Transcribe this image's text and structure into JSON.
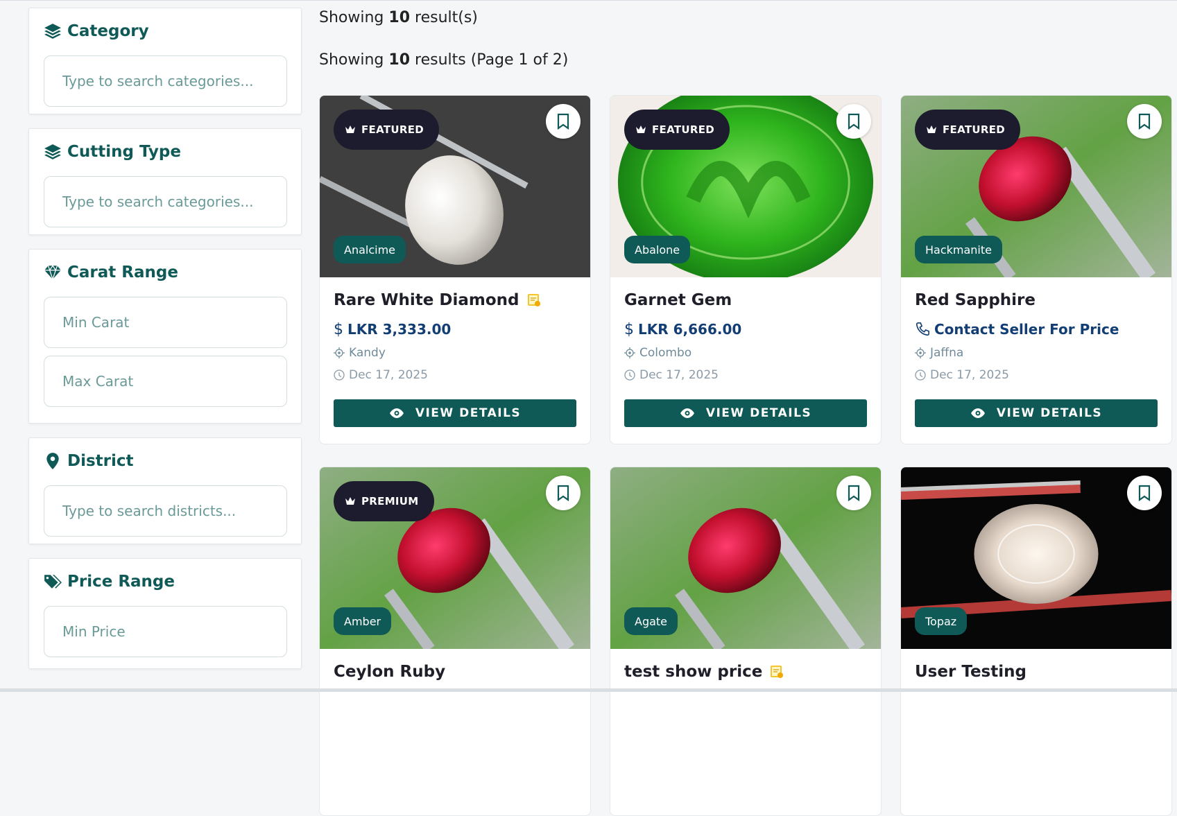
{
  "filters": [
    {
      "title": "Category",
      "icon": "layers-icon",
      "inputs": [
        "Type to search categories..."
      ]
    },
    {
      "title": "Cutting Type",
      "icon": "layers-icon",
      "inputs": [
        "Type to search categories..."
      ]
    },
    {
      "title": "Carat Range",
      "icon": "gem-icon",
      "inputs": [
        "Min Carat",
        "Max Carat"
      ]
    },
    {
      "title": "District",
      "icon": "map-pin-icon",
      "inputs": [
        "Type to search districts..."
      ]
    },
    {
      "title": "Price Range",
      "icon": "tags-icon",
      "inputs": [
        "Min Price"
      ]
    }
  ],
  "results": {
    "top_prefix": "Showing",
    "top_count": "10",
    "top_suffix": "result(s)",
    "page_prefix": "Showing",
    "page_count": "10",
    "page_suffix": "results (Page 1 of 2)"
  },
  "view_details_label": "VIEW DETAILS",
  "listings": [
    {
      "title": "Rare White Diamond",
      "certified": true,
      "badge": "FEATURED",
      "category": "Analcime",
      "price": "LKR 3,333.00",
      "price_type": "price",
      "location": "Kandy",
      "date": "Dec 17, 2025"
    },
    {
      "title": "Garnet Gem",
      "certified": false,
      "badge": "FEATURED",
      "category": "Abalone",
      "price": "LKR 6,666.00",
      "price_type": "price",
      "location": "Colombo",
      "date": "Dec 17, 2025"
    },
    {
      "title": "Red Sapphire",
      "certified": false,
      "badge": "FEATURED",
      "category": "Hackmanite",
      "price": "Contact Seller For Price",
      "price_type": "contact",
      "location": "Jaffna",
      "date": "Dec 17, 2025"
    },
    {
      "title": "Ceylon Ruby",
      "certified": false,
      "badge": "PREMIUM",
      "category": "Amber"
    },
    {
      "title": "test show price",
      "certified": true,
      "badge": "",
      "category": "Agate"
    },
    {
      "title": "User Testing",
      "certified": false,
      "badge": "",
      "category": "Topaz"
    }
  ],
  "colors": {
    "primary": "#0f5a57",
    "price": "#133e74",
    "badge_bg": "#1c1c2e"
  }
}
